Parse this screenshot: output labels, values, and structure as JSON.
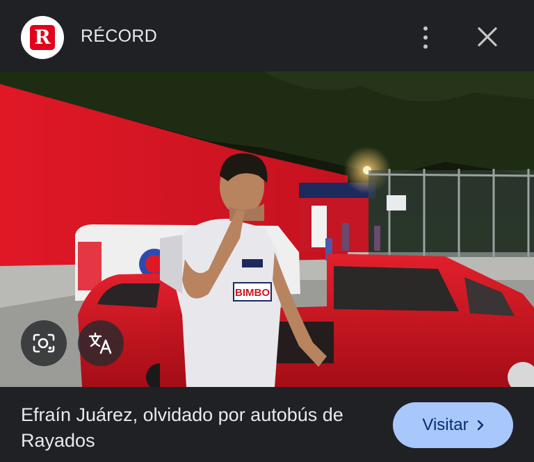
{
  "header": {
    "logo_letter": "R",
    "source_name": "RÉCORD",
    "more_icon": "more-vert-icon",
    "close_icon": "close-icon"
  },
  "image": {
    "jersey_text": "BIMBO",
    "lens_icon": "google-lens-icon",
    "translate_icon": "translate-icon"
  },
  "footer": {
    "caption": "Efraín Juárez, olvidado por autobús de Rayados",
    "visit_label": "Visitar"
  },
  "colors": {
    "background": "#202124",
    "brand_red": "#e3001b",
    "visit_button": "#a8c7fa"
  }
}
